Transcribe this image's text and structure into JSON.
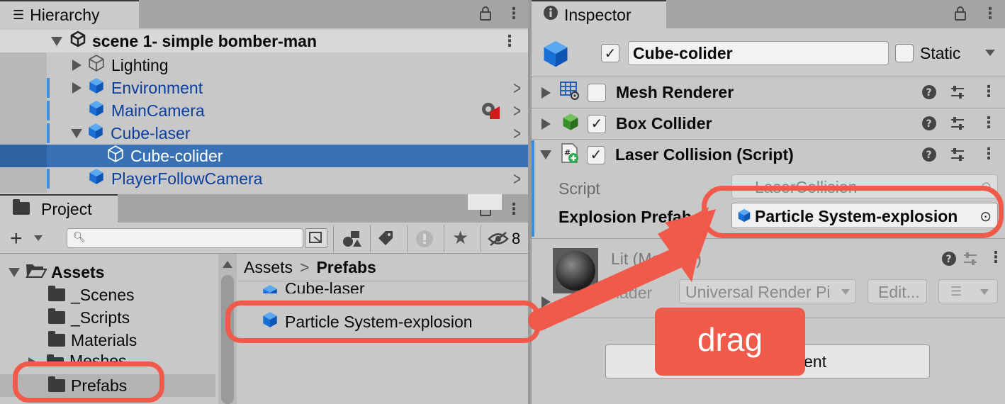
{
  "hierarchy": {
    "tab_label": "Hierarchy",
    "scene_name": "scene 1- simple bomber-man",
    "items": [
      {
        "label": "Lighting",
        "blue": false
      },
      {
        "label": "Environment",
        "blue": true
      },
      {
        "label": "MainCamera",
        "blue": true
      },
      {
        "label": "Cube-laser",
        "blue": true
      },
      {
        "label": "Cube-colider",
        "blue": false,
        "selected": true
      },
      {
        "label": "PlayerFollowCamera",
        "blue": true
      }
    ]
  },
  "project": {
    "tab_label": "Project",
    "search_placeholder": "",
    "hidden_count": "8",
    "tree": {
      "root": "Assets",
      "folders": [
        "_Scenes",
        "_Scripts",
        "Materials",
        "Meshes",
        "Prefabs"
      ]
    },
    "breadcrumb": {
      "root": "Assets",
      "sep": ">",
      "current": "Prefabs"
    },
    "files": [
      "Cube-laser",
      "Particle System-explosion"
    ]
  },
  "inspector": {
    "tab_label": "Inspector",
    "object_name": "Cube-colider",
    "static_label": "Static",
    "components": [
      {
        "name": "Mesh Renderer",
        "enabled": false
      },
      {
        "name": "Box Collider",
        "enabled": true
      },
      {
        "name": "Laser Collision (Script)",
        "enabled": true
      }
    ],
    "fields": {
      "script_label": "Script",
      "script_value": "LaserCollision",
      "prefab_label": "Explosion Prefab",
      "prefab_value": "Particle System-explosion"
    },
    "material": {
      "name": "Lit (Material)",
      "shader_label": "Shader",
      "shader_value": "Universal Render Pi",
      "edit_label": "Edit..."
    },
    "add_component_label": "Add Component"
  },
  "annotation": {
    "label": "drag",
    "color": "#f05a4a"
  }
}
